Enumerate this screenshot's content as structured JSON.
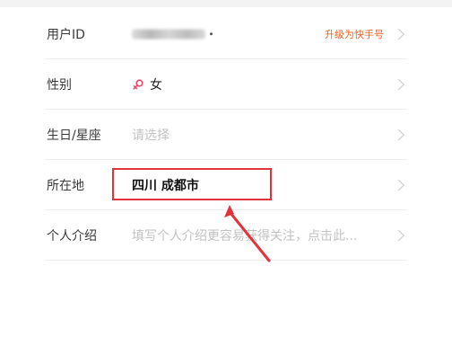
{
  "profile_rows": {
    "user_id": {
      "label": "用户ID",
      "action_text": "升级为快手号"
    },
    "gender": {
      "label": "性别",
      "value": "女",
      "icon": "female-icon"
    },
    "birthday": {
      "label": "生日/星座",
      "placeholder": "请选择"
    },
    "location": {
      "label": "所在地",
      "value": "四川 成都市"
    },
    "intro": {
      "label": "个人介绍",
      "placeholder": "填写个人介绍更容易获得关注，点击此..."
    }
  },
  "annotation": {
    "highlight_color": "#e2323a",
    "arrow_icon": "arrow-pointer-icon"
  },
  "colors": {
    "accent": "#f2611f",
    "placeholder": "#c2c2c2"
  }
}
